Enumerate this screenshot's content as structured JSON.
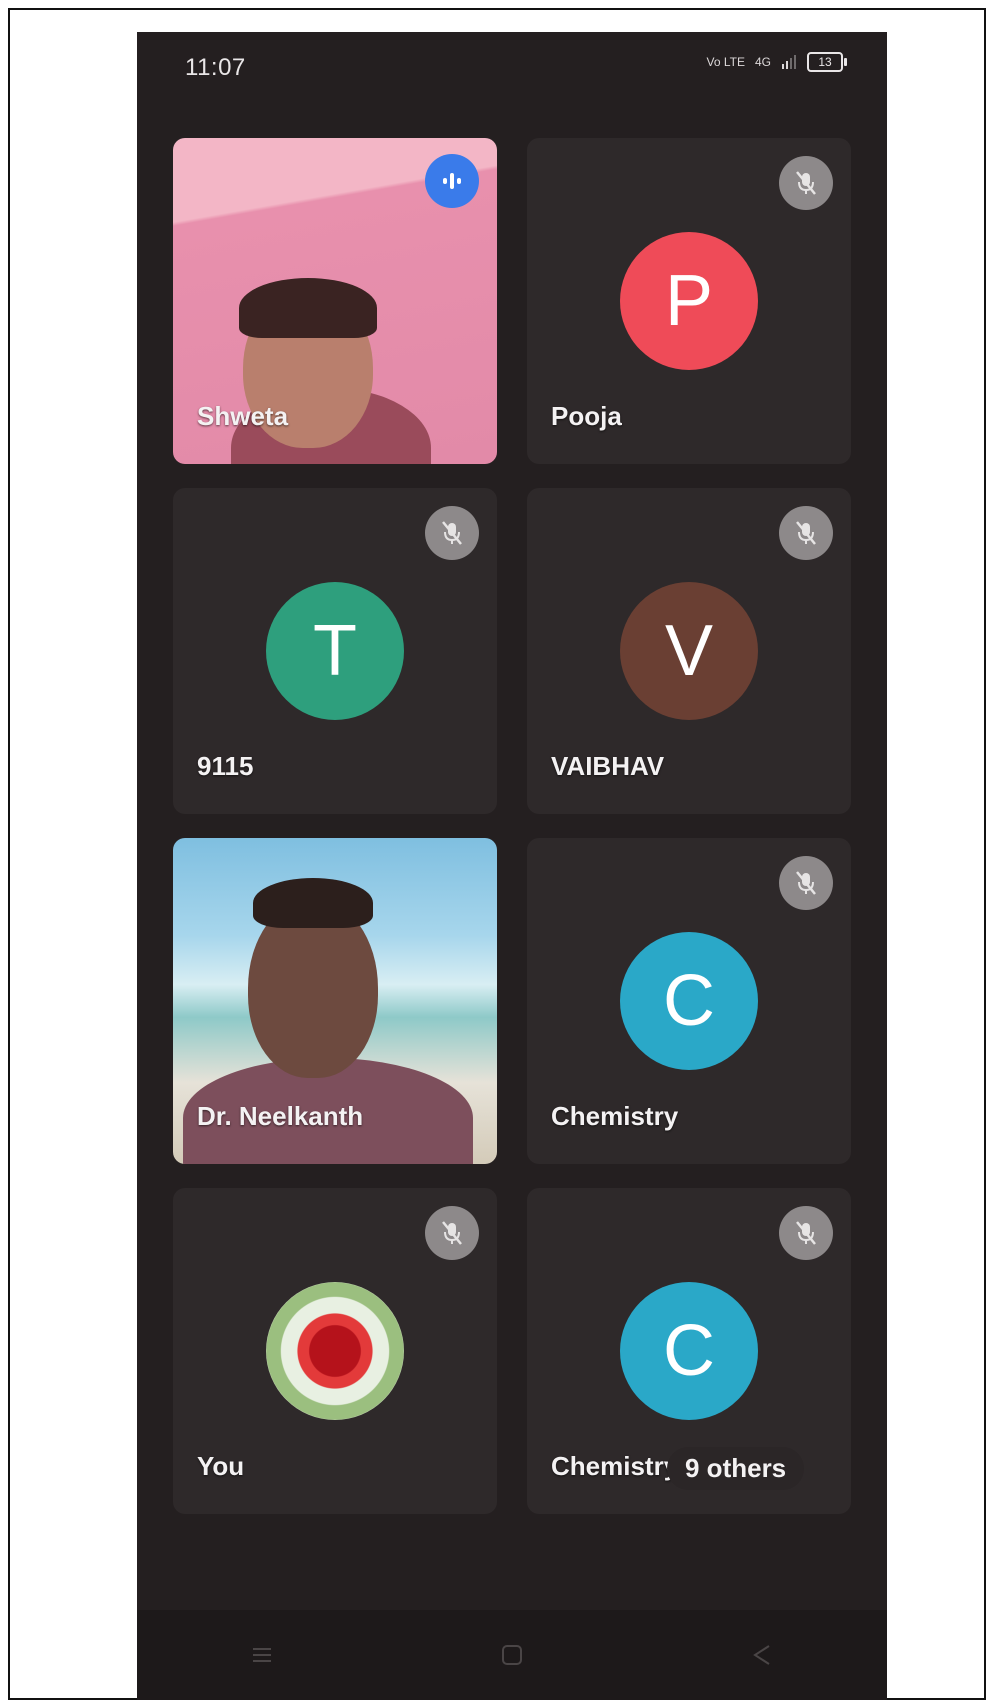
{
  "status_bar": {
    "time": "11:07",
    "network_label": "4G",
    "volte_label": "Vo LTE",
    "battery": "13"
  },
  "participants": [
    {
      "name": "Shweta",
      "type": "video",
      "muted": false,
      "speaking": true
    },
    {
      "name": "Pooja",
      "type": "avatar",
      "initial": "P",
      "avatar_color": "#ef4b58",
      "muted": true
    },
    {
      "name": "9115",
      "type": "avatar",
      "initial": "T",
      "avatar_color": "#2e9f7d",
      "muted": true
    },
    {
      "name": "VAIBHAV",
      "type": "avatar",
      "initial": "V",
      "avatar_color": "#6a3f33",
      "muted": true
    },
    {
      "name": "Dr. Neelkanth",
      "type": "video",
      "muted": false
    },
    {
      "name": "Chemistry",
      "type": "avatar",
      "initial": "C",
      "avatar_color": "#2aa8c8",
      "muted": true
    },
    {
      "name": "You",
      "type": "image-avatar",
      "muted": true
    },
    {
      "name": "Chemistry",
      "type": "avatar",
      "initial": "C",
      "avatar_color": "#2aa8c8",
      "muted": true
    }
  ],
  "others_label": "9 others",
  "icons": {
    "mute": "mic-off-icon",
    "speaking": "audio-level-icon",
    "nav_menu": "recent-apps-icon",
    "nav_home": "home-icon",
    "nav_back": "back-icon"
  }
}
